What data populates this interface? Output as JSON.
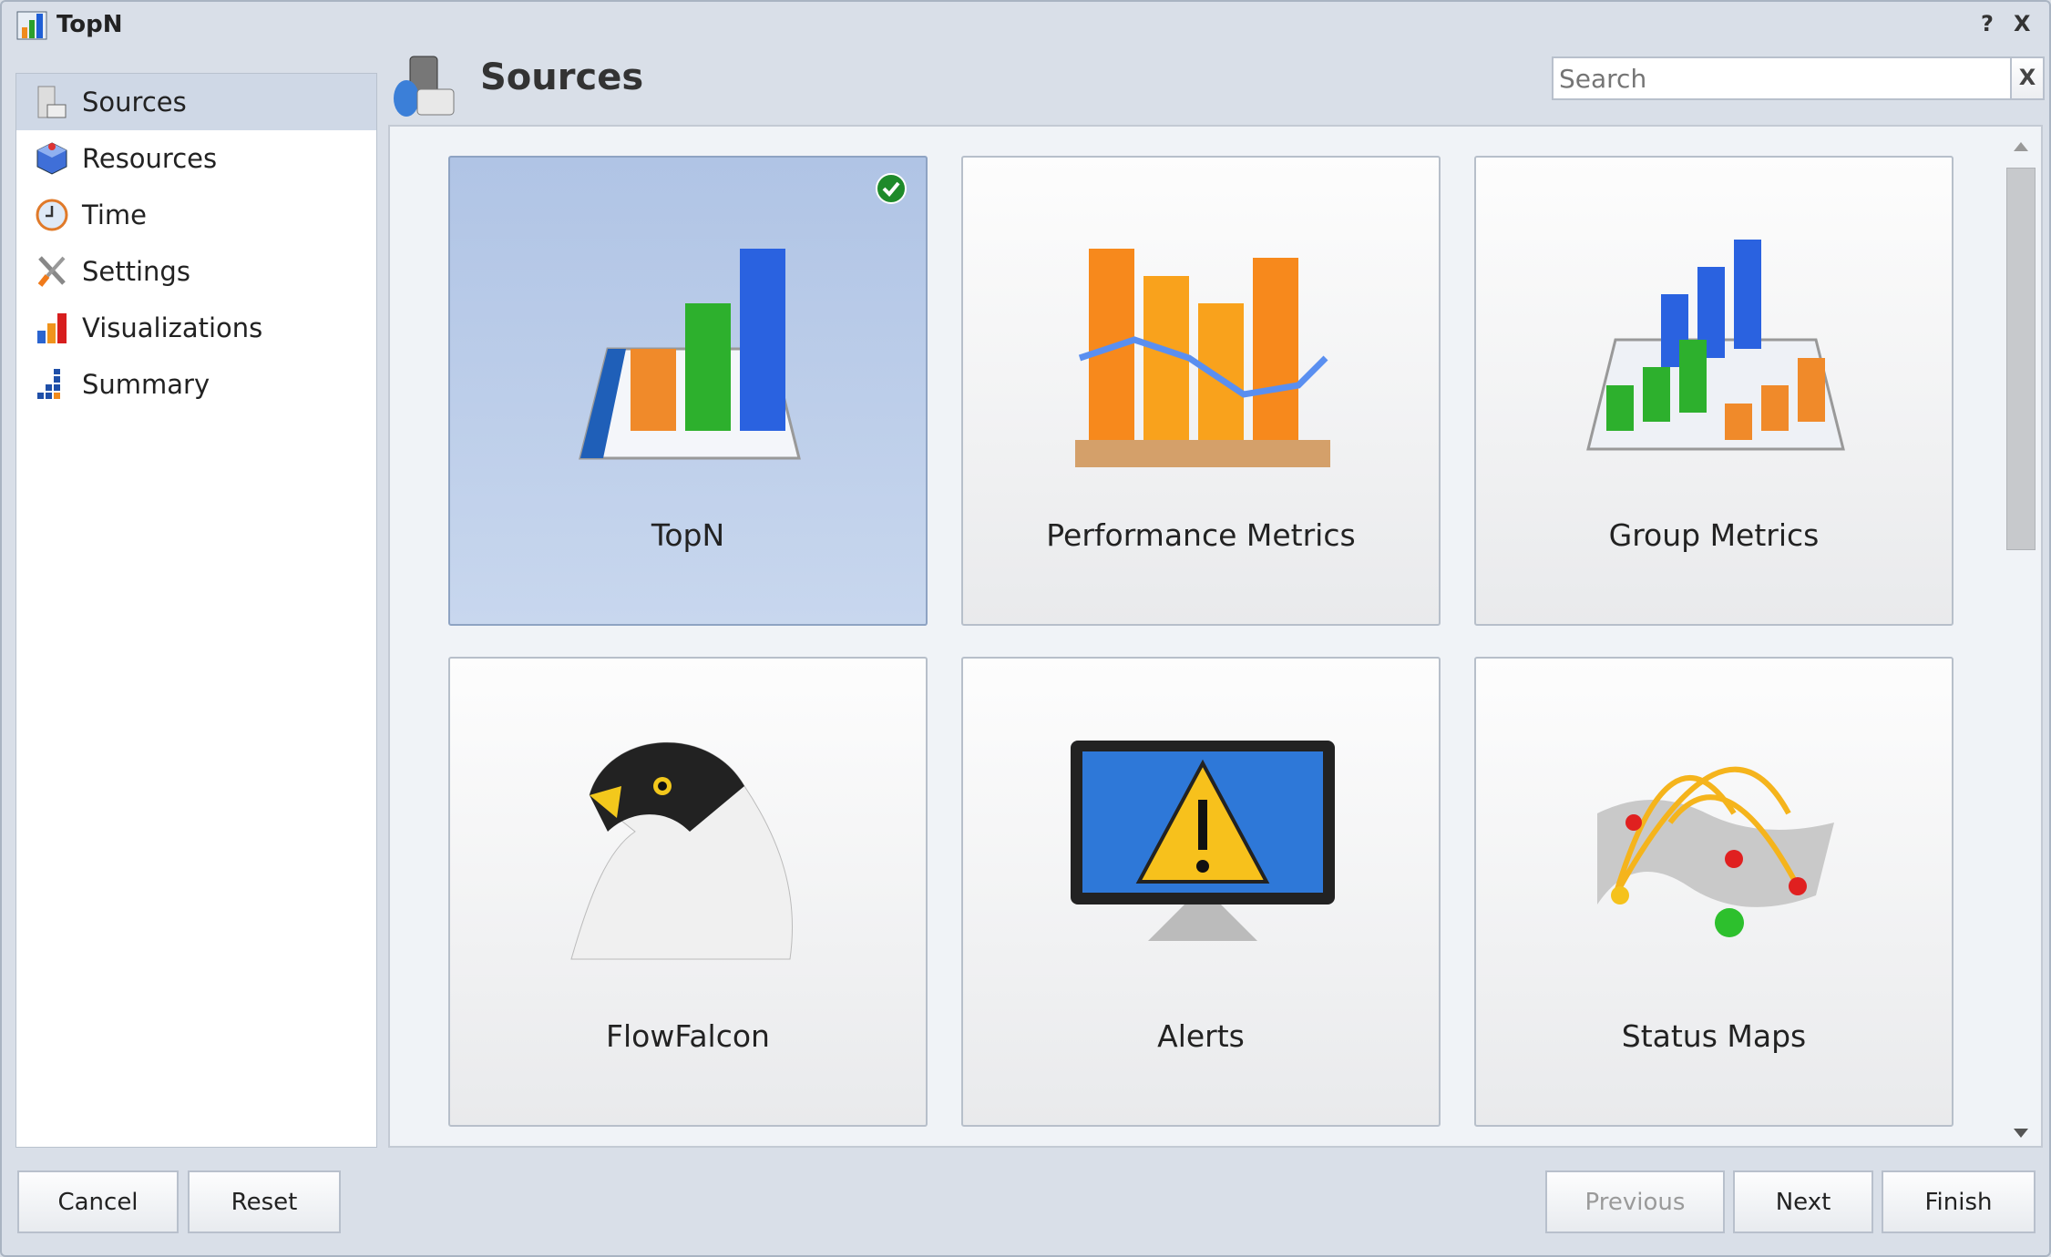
{
  "window": {
    "title": "TopN",
    "help_label": "?",
    "close_label": "X"
  },
  "sidebar": {
    "items": [
      {
        "label": "Sources",
        "icon": "server-icon",
        "selected": true
      },
      {
        "label": "Resources",
        "icon": "cube-icon"
      },
      {
        "label": "Time",
        "icon": "clock-icon"
      },
      {
        "label": "Settings",
        "icon": "tools-icon"
      },
      {
        "label": "Visualizations",
        "icon": "bar-chart-icon"
      },
      {
        "label": "Summary",
        "icon": "stairs-chart-icon"
      }
    ]
  },
  "header": {
    "title": "Sources",
    "icon": "sources-icon"
  },
  "search": {
    "placeholder": "Search",
    "value": "",
    "clear_label": "X"
  },
  "cards": [
    {
      "label": "TopN",
      "icon": "3d-bar-chart-icon",
      "selected": true
    },
    {
      "label": "Performance Metrics",
      "icon": "bar-line-chart-icon"
    },
    {
      "label": "Group Metrics",
      "icon": "grouped-bar-chart-icon"
    },
    {
      "label": "FlowFalcon",
      "icon": "falcon-icon"
    },
    {
      "label": "Alerts",
      "icon": "monitor-warning-icon"
    },
    {
      "label": "Status Maps",
      "icon": "world-map-icon"
    }
  ],
  "footer": {
    "cancel": "Cancel",
    "reset": "Reset",
    "previous": "Previous",
    "next": "Next",
    "finish": "Finish"
  },
  "colors": {
    "selected": "#b0c4e5",
    "check": "#1e8a2a"
  }
}
